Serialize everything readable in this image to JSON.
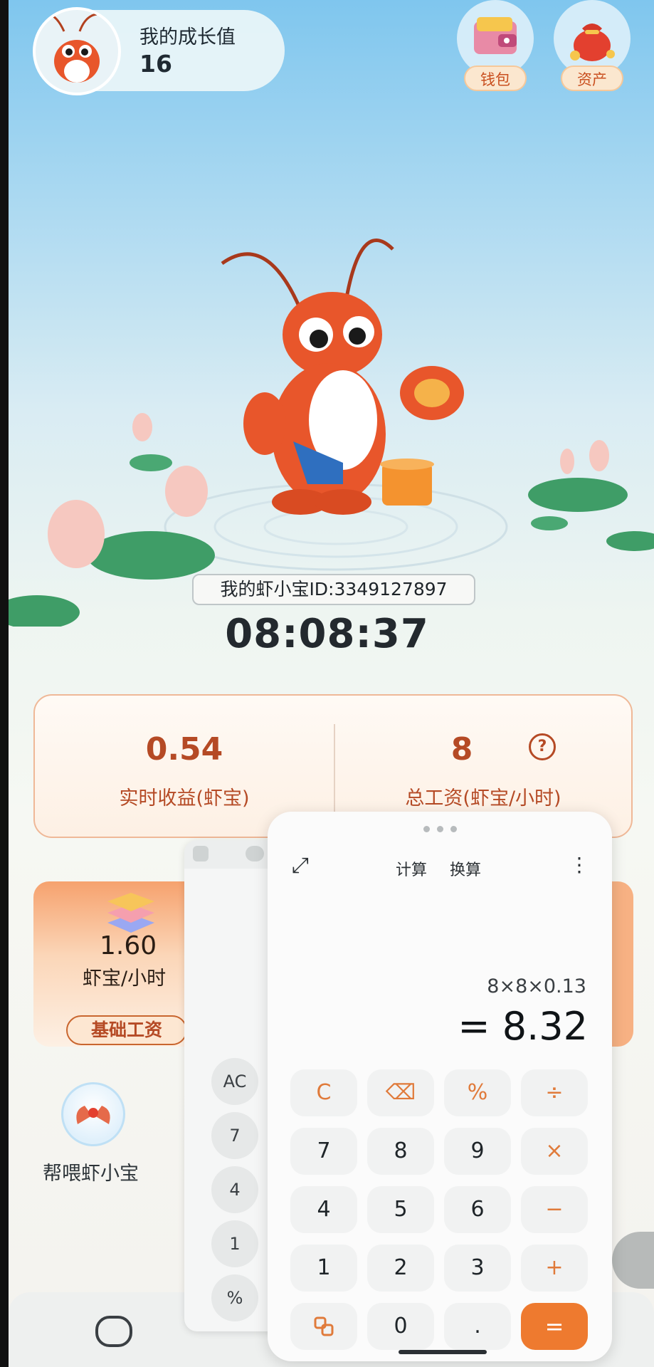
{
  "header": {
    "growth_label": "我的成长值",
    "growth_value": "16",
    "wallet_label": "钱包",
    "assets_label": "资产"
  },
  "pet": {
    "id_text": "我的虾小宝ID:3349127897",
    "clock": "08:08:37"
  },
  "stats": {
    "earnings_value": "0.54",
    "earnings_label": "实时收益(虾宝)",
    "wage_value": "8",
    "wage_label": "总工资(虾宝/小时)",
    "help_glyph": "?"
  },
  "wage_card": {
    "value": "1.60",
    "unit": "虾宝/小时",
    "tag": "基础工资"
  },
  "actions": {
    "feed_label": "帮喂虾小宝"
  },
  "mini_calc": {
    "keys": [
      "AC",
      "7",
      "4",
      "1",
      "%"
    ]
  },
  "calculator": {
    "tab_calc": "计算",
    "tab_convert": "换算",
    "menu_glyph": "⋮",
    "expand_glyph": "⤢",
    "expression": "8×8×0.13",
    "result": "= 8.32",
    "keys": {
      "clear": "C",
      "backspace": "⌫",
      "percent": "%",
      "divide": "÷",
      "seven": "7",
      "eight": "8",
      "nine": "9",
      "multiply": "×",
      "four": "4",
      "five": "5",
      "six": "6",
      "minus": "−",
      "one": "1",
      "two": "2",
      "three": "3",
      "plus": "+",
      "zero": "0",
      "dot": ".",
      "equals": "="
    }
  },
  "colors": {
    "accent": "#ee7a2f",
    "brand_text": "#b54a25"
  }
}
